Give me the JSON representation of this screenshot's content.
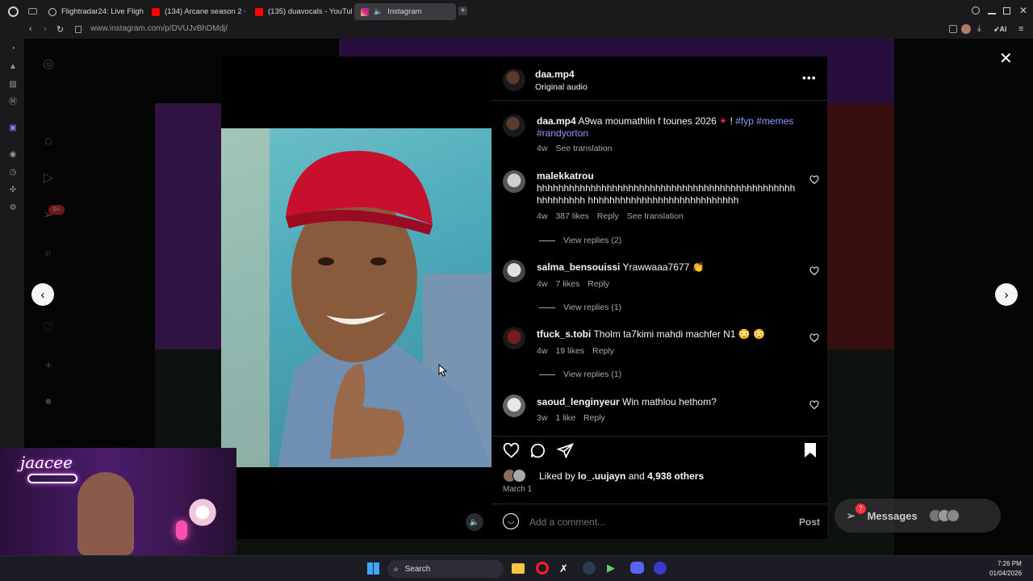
{
  "browser": {
    "tabs": [
      {
        "label": "Flightradar24: Live Flight T",
        "color": "#9aa3ff"
      },
      {
        "label": "(134) Arcane season 2 - I",
        "color": "#ff0000"
      },
      {
        "label": "(135) duavocals - YouTube",
        "color": "#ff0000"
      },
      {
        "label": "Instagram",
        "color": "#e1306c"
      }
    ],
    "url": "www.instagram.com/p/DVUJvBhDMdj/",
    "ai_label": "AI"
  },
  "post": {
    "author": "daa.mp4",
    "audio": "Original audio",
    "caption_text": "A9wa moumathlin f tounes 2026",
    "caption_emoji": "✴",
    "caption_bang": "!",
    "tags_1": "#fyp #memes",
    "tags_2": "#randyorton",
    "caption_time": "4w",
    "see_translation": "See translation",
    "liked_by_prefix": "Liked by",
    "liked_by_user": "lo_.uujayn",
    "liked_by_and": "and",
    "liked_by_others": "4,938 others",
    "date": "March 1",
    "comment_placeholder": "Add a comment...",
    "post_button": "Post"
  },
  "comments": [
    {
      "user": "malekkatrou",
      "text": "hhhhhhhhhhhhhhhhhhhhhhhhhhhhhhhhhhhhhhhhhhhhhhhhhhhhhhhhh hhhhhhhhhhhhhhhhhhhhhhhhhhhh",
      "time": "4w",
      "likes": "387 likes",
      "reply": "Reply",
      "translation": "See translation",
      "view_replies": "View replies (2)"
    },
    {
      "user": "salma_bensouissi",
      "text": "Yrawwaaa7677 👏",
      "time": "4w",
      "likes": "7 likes",
      "reply": "Reply",
      "view_replies": "View replies (1)"
    },
    {
      "user": "tfuck_s.tobi",
      "text": "Tholm ta7kimi mahdi machfer N1 😳 😳",
      "time": "4w",
      "likes": "19 likes",
      "reply": "Reply",
      "view_replies": "View replies (1)"
    },
    {
      "user": "saoud_lenginyeur",
      "text": "Win mathlou hethom?",
      "time": "3w",
      "likes": "1 like",
      "reply": "Reply"
    }
  ],
  "messages_label": "Messages",
  "messages_badge": "7",
  "notif_badge": "9+",
  "taskbar": {
    "search_label": "Search",
    "time": "7:26 PM",
    "date": "01/04/2026"
  },
  "webcam_name": "jaacee",
  "colors": {
    "accent_link": "#e0f1ff",
    "hashtag": "#8a9cff",
    "badge": "#ff3040"
  }
}
